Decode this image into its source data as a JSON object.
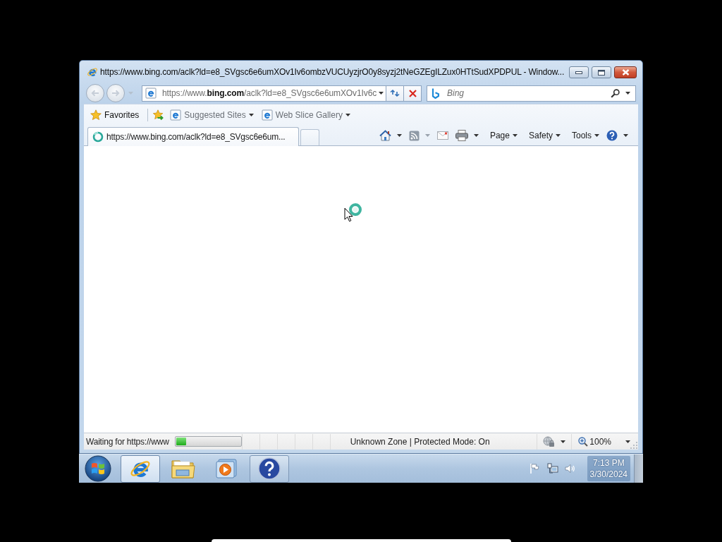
{
  "window": {
    "title": "https://www.bing.com/aclk?ld=e8_SVgsc6e6umXOv1Iv6ombzVUCUyzjrO0y8syzj2tNeGZEgILZux0HTtSudXPDPUL - Window..."
  },
  "navigation": {
    "address": "https://www.**bing.com**/aclk?ld=e8_SVgsc6e6umXOv1Iv6c",
    "search": {
      "placeholder": "Bing"
    }
  },
  "favorites_bar": {
    "label": "Favorites",
    "items": [
      {
        "label": "Suggested Sites"
      },
      {
        "label": "Web Slice Gallery"
      }
    ]
  },
  "tabs": [
    {
      "label": "https://www.bing.com/aclk?ld=e8_SVgsc6e6um...",
      "selected": true,
      "loading": true
    }
  ],
  "command_bar": {
    "menus": [
      {
        "label": "Page"
      },
      {
        "label": "Safety"
      },
      {
        "label": "Tools"
      }
    ]
  },
  "status_bar": {
    "text": "Waiting for https://www",
    "progress": {
      "level": 0.16
    },
    "zone": "Unknown Zone | Protected Mode: On",
    "zoom": "100%"
  },
  "taskbar": {
    "buttons": [
      {
        "kind": "ie",
        "running": true,
        "selected": true
      },
      {
        "kind": "explorer",
        "running": false,
        "selected": false
      },
      {
        "kind": "media",
        "running": false,
        "selected": false
      },
      {
        "kind": "help",
        "running": true,
        "selected": false
      }
    ]
  },
  "clock": {
    "time": "7:13 PM",
    "date": "3/30/2024"
  }
}
